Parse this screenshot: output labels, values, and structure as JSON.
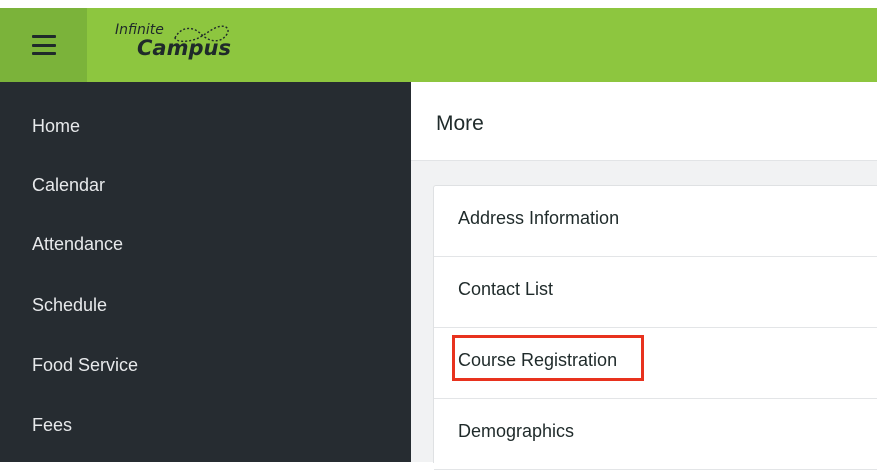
{
  "app": {
    "logo_top": "Infinite",
    "logo_bottom": "Campus",
    "menu_icon": "hamburger-icon",
    "brand_color": "#8dc63f"
  },
  "sidebar": {
    "items": [
      {
        "label": "Home"
      },
      {
        "label": "Calendar"
      },
      {
        "label": "Attendance"
      },
      {
        "label": "Schedule"
      },
      {
        "label": "Food Service"
      },
      {
        "label": "Fees"
      }
    ]
  },
  "main": {
    "title": "More",
    "list": [
      {
        "label": "Address Information"
      },
      {
        "label": "Contact List"
      },
      {
        "label": "Course Registration",
        "highlighted": true
      },
      {
        "label": "Demographics"
      }
    ],
    "highlight_color": "#e8321e"
  }
}
